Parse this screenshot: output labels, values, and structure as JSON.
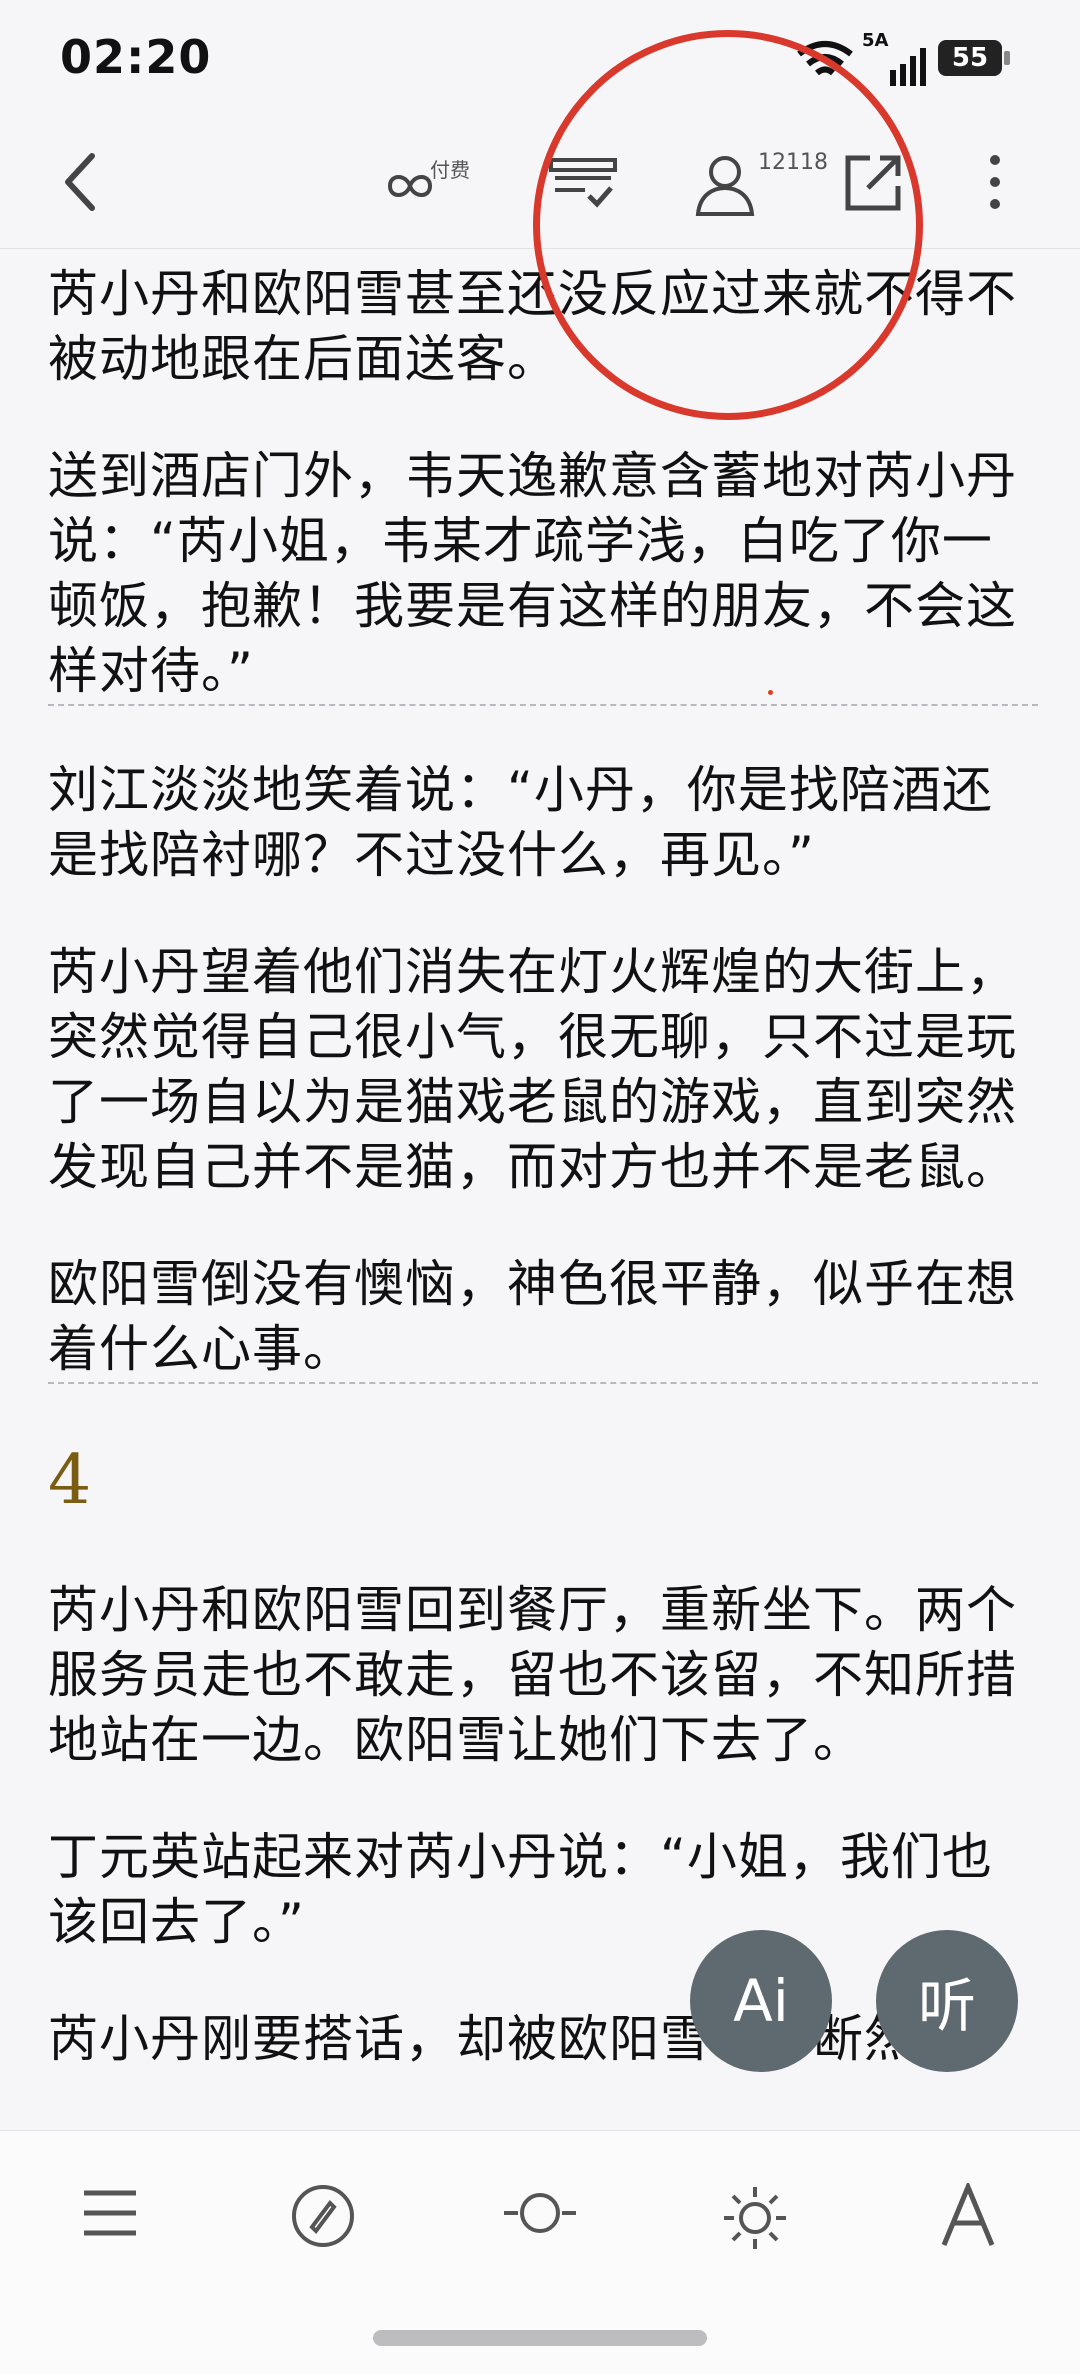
{
  "status_bar": {
    "time": "02:20",
    "network": "5A",
    "battery": "55"
  },
  "toolbar": {
    "pay_label": "付费",
    "reader_count": "12118"
  },
  "content": {
    "paragraphs": [
      "芮小丹和欧阳雪甚至还没反应过来就不得不被动地跟在后面送客。",
      "送到酒店门外，韦天逸歉意含蓄地对芮小丹说：“芮小姐，韦某才疏学浅，白吃了你一顿饭，抱歉！我要是有这样的朋友，不会这样对待。”",
      "刘江淡淡地笑着说：“小丹，你是找陪酒还是找陪衬哪？不过没什么，再见。”",
      "芮小丹望着他们消失在灯火辉煌的大街上，突然觉得自己很小气，很无聊，只不过是玩了一场自以为是猫戏老鼠的游戏，直到突然发现自己并不是猫，而对方也并不是老鼠。",
      "欧阳雪倒没有懊恼，神色很平静，似乎在想着什么心事。",
      "芮小丹和欧阳雪回到餐厅，重新坐下。两个服务员走也不敢走，留也不该留，不知所措地站在一边。欧阳雪让她们下去了。",
      "丁元英站起来对芮小丹说：“小姐，我们也该回去了。”",
      "芮小丹刚要搭话，却被欧阳雪一个断然的"
    ],
    "chapter_number": "4"
  },
  "fabs": {
    "ai_label": "Ai",
    "listen_label": "听"
  },
  "colors": {
    "accent_chapter": "#7a5c12",
    "annotation_circle": "#d9392c",
    "fab_bg": "#5e6a70"
  }
}
